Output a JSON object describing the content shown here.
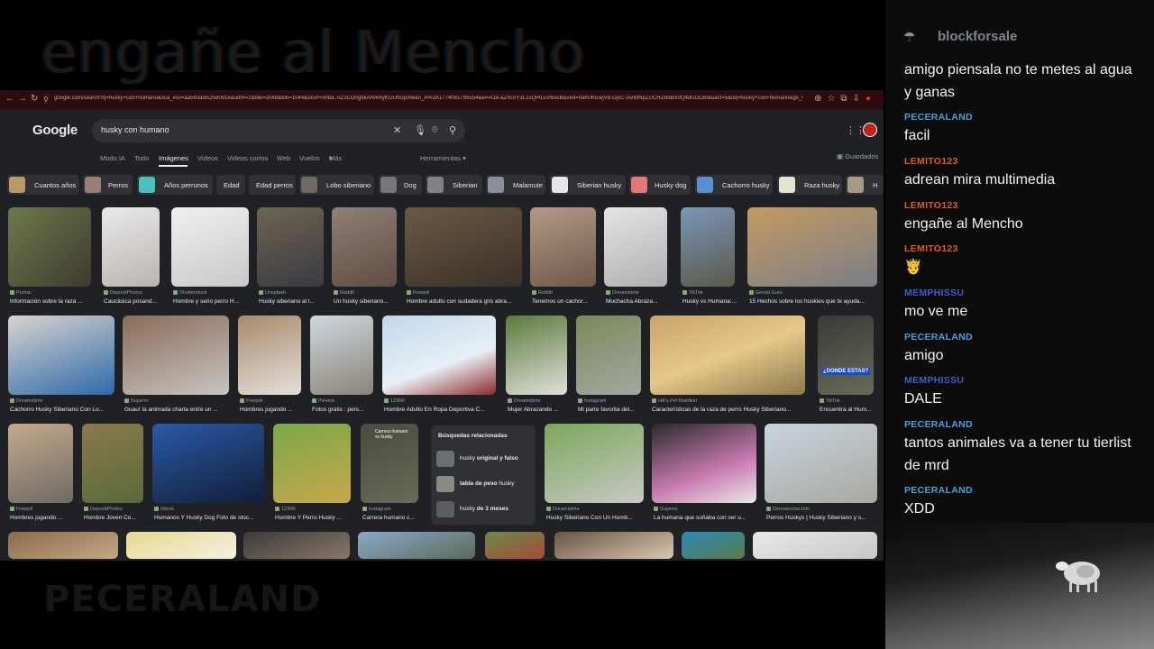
{
  "overlay": {
    "top_text": "engañe al Mencho",
    "bottom_text": "PECERALAND"
  },
  "browser": {
    "url": "google.com/search?q=husky+con+humano&sca_esv=aa563a5fc25e091e&udm=2&biw=2048&bih=1044&sxsrf=ANbL-nZ2COng9kAhWRyKGUhGjohwan_A%3A1774081795554&ei=A1e-aZXGIY3L1sQPlLuV6AcB&ved=0ahUKEwjV8-GjxCTAxWNpZUCHZBdBX0Q4dUDCBI&uact=5&oq=husky+con+humano&gs_lp=Egtnd3Mtd2l6LWltZyIQaHVza3kgY29uIGh1bWFubw"
  },
  "google": {
    "logo": "Google",
    "query": "husky con humano",
    "tabs": [
      "Modo IA",
      "Todo",
      "Imágenes",
      "Videos",
      "Videos cortos",
      "Web",
      "Vuelos",
      "Más"
    ],
    "tools": "Herramientas",
    "saved": "Guardados",
    "chips": [
      "Cuantos años",
      "Perros",
      "Años perrunos",
      "Edad",
      "Edad perros",
      "Lobo siberiano",
      "Dog",
      "Siberian",
      "Malamute",
      "Siberian husky",
      "Husky dog",
      "Cachorro husky",
      "Raza husky",
      "H"
    ],
    "row1": [
      {
        "src": "Purina",
        "cap": "Información sobre la raza ..."
      },
      {
        "src": "DepositPhotos",
        "cap": "Caucásica posand..."
      },
      {
        "src": "Shutterstock",
        "cap": "Hombre y serio perro H..."
      },
      {
        "src": "Unsplash",
        "cap": "Husky siberiano al l..."
      },
      {
        "src": "Reddit",
        "cap": "Un husky siberiano..."
      },
      {
        "src": "Freepik",
        "cap": "Hombre adulto con sudadera gris abra..."
      },
      {
        "src": "Reddit",
        "cap": "Tenemos un cachor..."
      },
      {
        "src": "Dreamstime",
        "cap": "Muchacha Abraza..."
      },
      {
        "src": "TikTok",
        "cap": "Husky vs Humana:..."
      },
      {
        "src": "Genial Guru",
        "cap": "15 Hechos sobre los huskies que te ayuda..."
      }
    ],
    "row2": [
      {
        "src": "Dreamstime",
        "cap": "Cachorro Husky Siberiano Con Lo..."
      },
      {
        "src": "Superro",
        "cap": "Guau! la animada charla entre un ..."
      },
      {
        "src": "Freepik",
        "cap": "Hombres jugando ..."
      },
      {
        "src": "PxHere",
        "cap": "Fotos gratis : pers..."
      },
      {
        "src": "123RF",
        "cap": "Hombre Adulto En Ropa Deportiva C..."
      },
      {
        "src": "Dreamstime",
        "cap": "Mujer Abrazando ..."
      },
      {
        "src": "Instagram",
        "cap": "Mi parte favorita del..."
      },
      {
        "src": "Hill's Pet Nutrition",
        "cap": "Características de la raza de perro Husky Siberiano..."
      },
      {
        "src": "TikTok",
        "cap": "Encuentra al Hum..."
      }
    ],
    "row3": [
      {
        "src": "Freepik",
        "cap": "Hombres jugando ..."
      },
      {
        "src": "DepositPhotos",
        "cap": "Hombre Joven Co..."
      },
      {
        "src": "iStock",
        "cap": "Humanos Y Husky Dog Foto de stoc..."
      },
      {
        "src": "123RF",
        "cap": "Hombre Y Perro Husky ..."
      },
      {
        "src": "Instagram",
        "cap": "Carrera humano c..."
      },
      {
        "src": "Dreamstime",
        "cap": "Husky Siberiano Con Un Homb..."
      },
      {
        "src": "Superro",
        "cap": "La humana que soñaba con ser u..."
      },
      {
        "src": "Demascotas.info",
        "cap": "Perros Huskys | Husky Siberiano y s..."
      }
    ],
    "tile_labels": {
      "donde_estas": "¿DONDE ESTAS?",
      "carrera": "Carrera humano vs husky"
    },
    "related": {
      "title": "Búsquedas relacionadas",
      "items": [
        {
          "pre": "husky ",
          "bold": "original y falso"
        },
        {
          "pre": "",
          "bold": "tabla de peso",
          "post": " husky"
        },
        {
          "pre": "husky ",
          "bold": "de 3 meses"
        }
      ]
    }
  },
  "chat": {
    "logo": "blockforsale",
    "messages": [
      {
        "name": "",
        "text": "amigo piensala no te metes al agua y ganas"
      },
      {
        "name": "PECERALAND",
        "text": "facil"
      },
      {
        "name": "LEMITO123",
        "text": "adrean mira multimedia"
      },
      {
        "name": "LEMITO123",
        "text": "engañe al Mencho"
      },
      {
        "name": "LEMITO123",
        "text": "🤴"
      },
      {
        "name": "MEMPHISSU",
        "text": "mo ve me"
      },
      {
        "name": "PECERALAND",
        "text": "amigo"
      },
      {
        "name": "MEMPHISSU",
        "text": "DALE"
      },
      {
        "name": "PECERALAND",
        "text": "tantos animales va a tener tu tierlist de mrd"
      },
      {
        "name": "PECERALAND",
        "text": "XDD"
      }
    ]
  },
  "colors": {
    "peceraland": "#4aa0d8",
    "lemito": "#e05a2a",
    "memphissu": "#3b5fd0",
    "google_bg": "#202124",
    "url_bar": "#2b0d0f"
  }
}
